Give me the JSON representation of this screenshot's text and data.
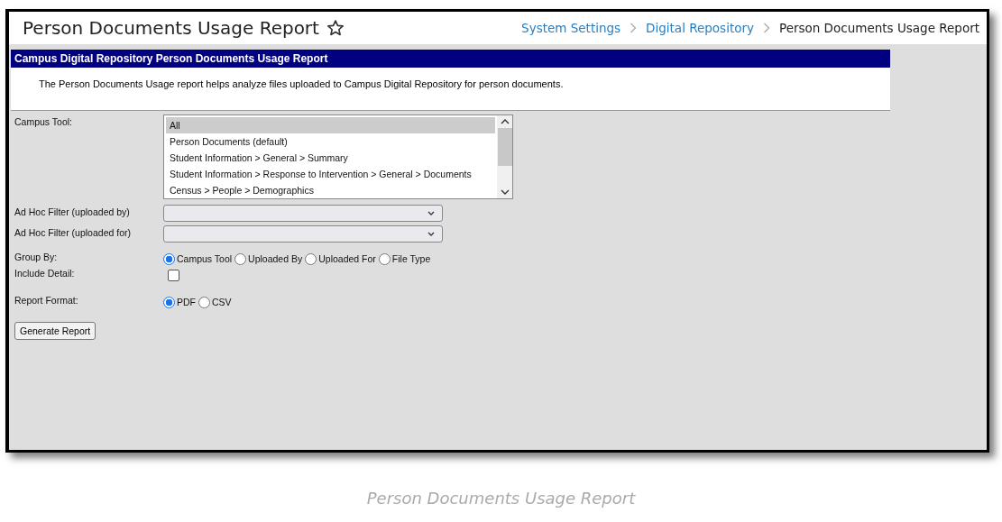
{
  "header": {
    "title": "Person Documents Usage Report",
    "breadcrumbs": [
      {
        "label": "System Settings",
        "link": true
      },
      {
        "label": "Digital Repository",
        "link": true
      },
      {
        "label": "Person Documents Usage Report",
        "link": false
      }
    ]
  },
  "banner": {
    "title": "Campus Digital Repository Person Documents Usage Report",
    "description": "The Person Documents Usage report helps analyze files uploaded to Campus Digital Repository for person documents."
  },
  "form": [
    {
      "kind": "listbox",
      "label": "Campus Tool:",
      "options": [
        {
          "label": "All",
          "selected": true
        },
        {
          "label": "Person Documents (default)",
          "selected": false
        },
        {
          "label": "Student Information > General > Summary",
          "selected": false
        },
        {
          "label": "Student Information > Response to Intervention > General > Documents",
          "selected": false
        },
        {
          "label": "Census > People > Demographics",
          "selected": false
        }
      ]
    },
    {
      "kind": "select",
      "label": "Ad Hoc Filter (uploaded by)"
    },
    {
      "kind": "select",
      "label": "Ad Hoc Filter (uploaded for)"
    },
    {
      "kind": "radios",
      "label": "Group By:",
      "options": [
        {
          "label": "Campus Tool",
          "selected": true
        },
        {
          "label": "Uploaded By",
          "selected": false
        },
        {
          "label": "Uploaded For",
          "selected": false
        },
        {
          "label": "File Type",
          "selected": false
        }
      ]
    },
    {
      "kind": "checkbox",
      "label": "Include Detail:",
      "checked": false
    },
    {
      "kind": "radios",
      "label": "Report Format:",
      "options": [
        {
          "label": "PDF",
          "selected": true
        },
        {
          "label": "CSV",
          "selected": false
        }
      ]
    }
  ],
  "button": "Generate Report",
  "caption": "Person Documents Usage Report"
}
